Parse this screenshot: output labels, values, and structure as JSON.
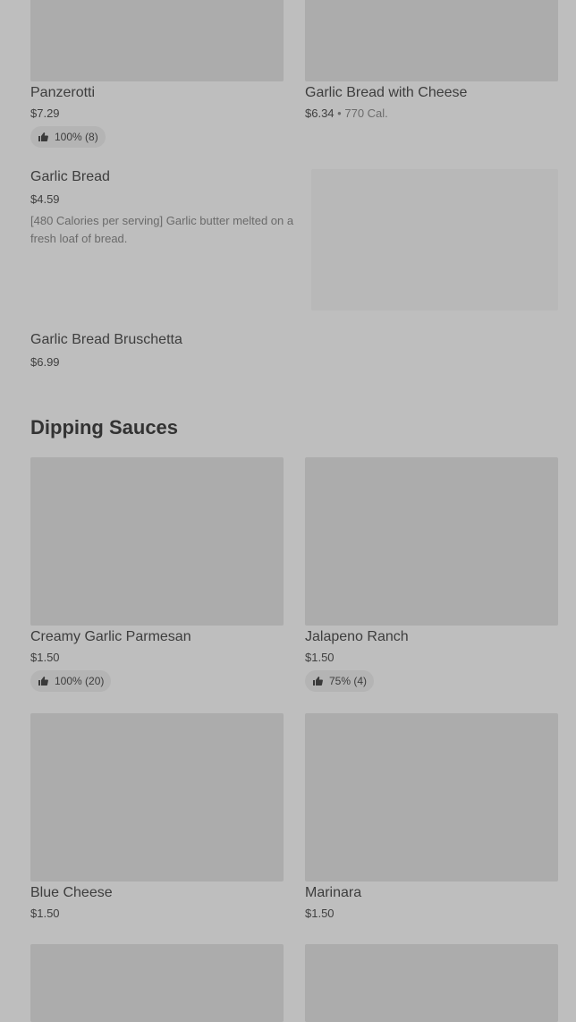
{
  "items_top": [
    {
      "name": "Panzerotti",
      "price": "$7.29",
      "rating": "100% (8)"
    },
    {
      "name": "Garlic Bread with Cheese",
      "price": "$6.34",
      "separator": "•",
      "calories": "770 Cal."
    }
  ],
  "item_garlic_bread": {
    "name": "Garlic Bread",
    "price": "$4.59",
    "description": "[480 Calories per serving] Garlic butter melted on a fresh loaf of bread."
  },
  "item_bruschetta": {
    "name": "Garlic Bread Bruschetta",
    "price": "$6.99"
  },
  "dipping_sauces": {
    "title": "Dipping Sauces",
    "items": [
      {
        "name": "Creamy Garlic Parmesan",
        "price": "$1.50",
        "rating": "100% (20)"
      },
      {
        "name": "Jalapeno Ranch",
        "price": "$1.50",
        "rating": "75% (4)"
      },
      {
        "name": "Blue Cheese",
        "price": "$1.50"
      },
      {
        "name": "Marinara",
        "price": "$1.50"
      }
    ]
  },
  "icons": {
    "rating": "thumbs-up-icon"
  },
  "colors": {
    "background": "#bebebe",
    "image_placeholder": "#acacac",
    "badge": "#b4b4b4"
  }
}
